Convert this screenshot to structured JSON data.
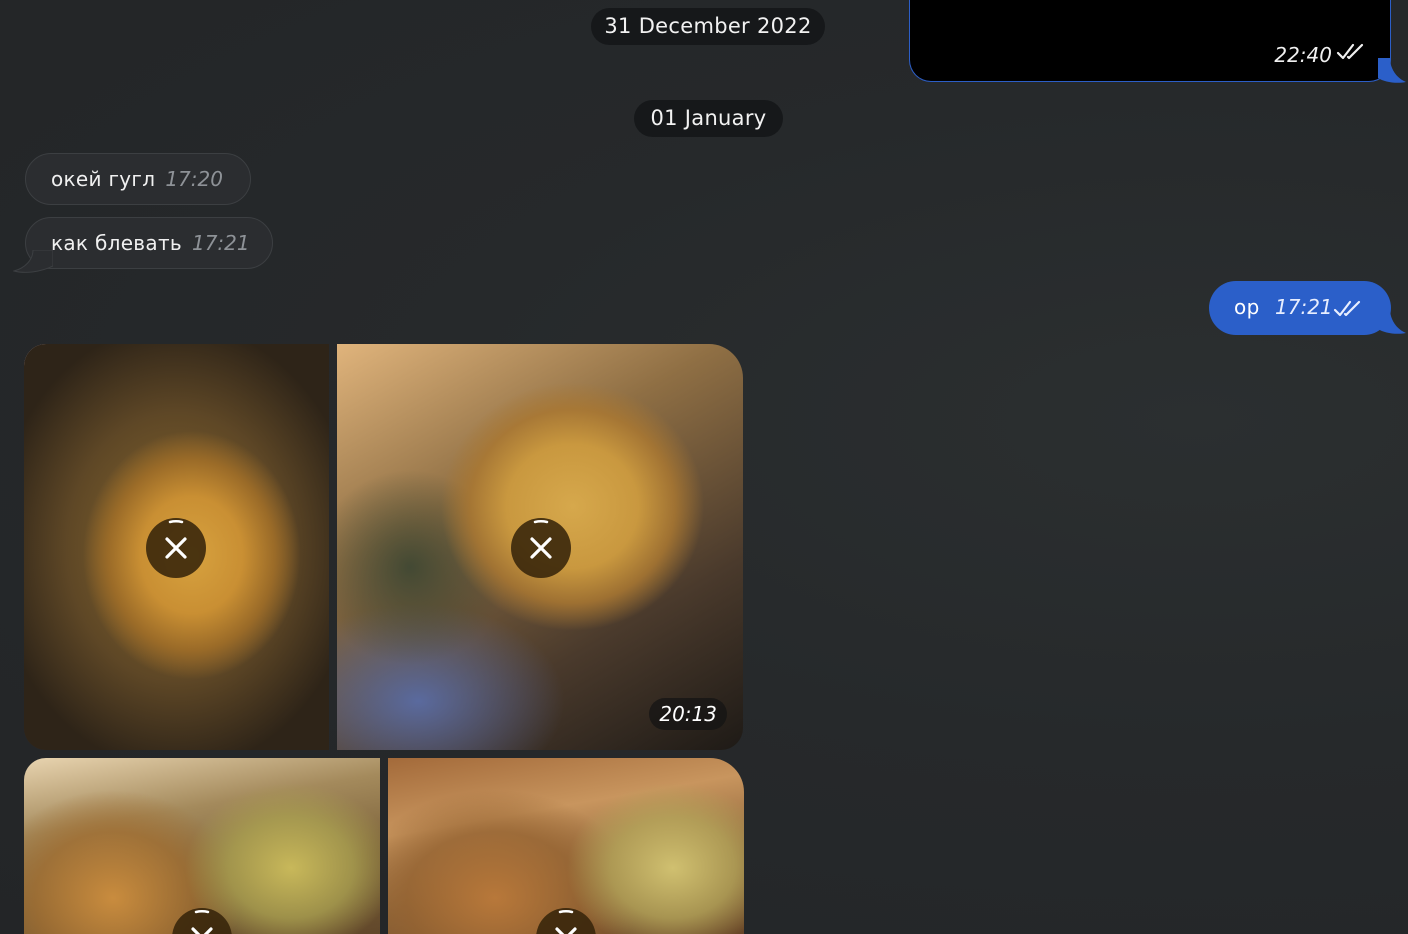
{
  "chat": {
    "date_separators": {
      "first": "31 December 2022",
      "second": "01 January"
    },
    "outgoing_dark_message": {
      "time": "22:40",
      "status_icon": "double-check-icon"
    },
    "incoming_messages": [
      {
        "text": "окей гугл",
        "time": "17:20"
      },
      {
        "text": "как блевать",
        "time": "17:21"
      }
    ],
    "outgoing_message": {
      "text": "ор",
      "time": "17:21",
      "status_icon": "double-check-icon"
    },
    "photo_album": {
      "time": "20:13",
      "cancel_icon": "close-icon"
    }
  },
  "colors": {
    "background": "#25272a",
    "outgoing_bubble": "#2b5fc9",
    "incoming_bubble": "#2b2d30",
    "date_chip": "#16181a"
  }
}
